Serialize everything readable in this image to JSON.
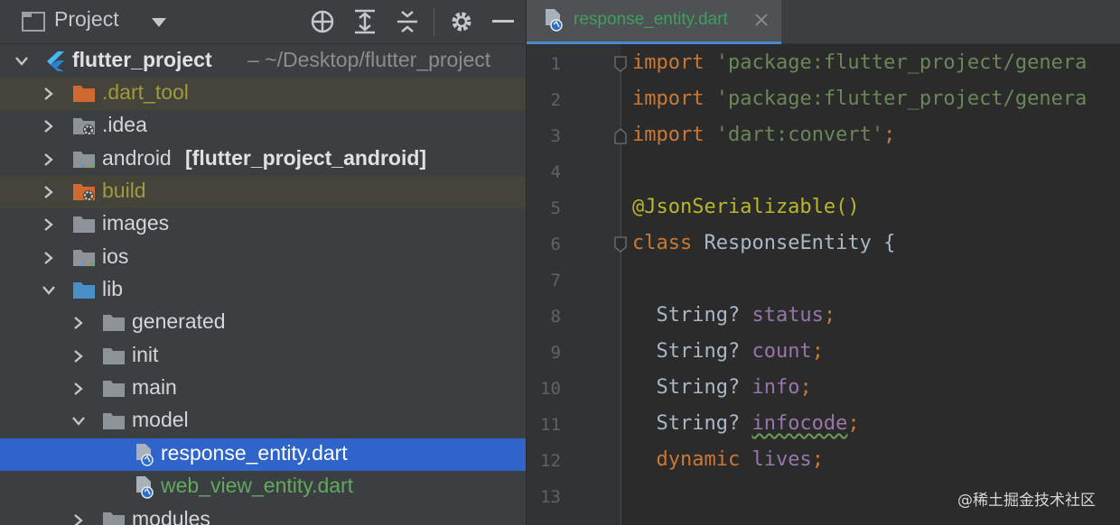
{
  "project_panel": {
    "title": "Project",
    "header_icons": [
      "crosshair-icon",
      "expand-all-icon",
      "collapse-all-icon",
      "gear-icon",
      "minimize-icon"
    ],
    "root": {
      "name": "flutter_project",
      "path": "~/Desktop/flutter_project"
    },
    "items": [
      {
        "label": ".dart_tool"
      },
      {
        "label": ".idea"
      },
      {
        "label": "android",
        "suffix": "[flutter_project_android]"
      },
      {
        "label": "build"
      },
      {
        "label": "images"
      },
      {
        "label": "ios"
      },
      {
        "label": "lib"
      },
      {
        "label": "generated"
      },
      {
        "label": "init"
      },
      {
        "label": "main"
      },
      {
        "label": "model"
      },
      {
        "label": "response_entity.dart"
      },
      {
        "label": "web_view_entity.dart"
      },
      {
        "label": "modules"
      }
    ]
  },
  "editor": {
    "tab": {
      "label": "response_entity.dart"
    },
    "line_numbers": [
      "1",
      "2",
      "3",
      "4",
      "5",
      "6",
      "7",
      "8",
      "9",
      "10",
      "11",
      "12",
      "13"
    ],
    "code": {
      "l1_kw": "import",
      "l1_str": " 'package:flutter_project/genera",
      "l2_kw": "import",
      "l2_str": " 'package:flutter_project/genera",
      "l3_kw": "import",
      "l3_str": " 'dart:convert'",
      "l3_end": ";",
      "l5_ann": "@JsonSerializable",
      "l5_rest": "()",
      "l6_kw": "class",
      "l6_rest": " ResponseEntity {",
      "l8_type": "  String? ",
      "l8_field": "status",
      "l8_end": ";",
      "l9_type": "  String? ",
      "l9_field": "count",
      "l9_end": ";",
      "l10_type": "  String? ",
      "l10_field": "info",
      "l10_end": ";",
      "l11_type": "  String? ",
      "l11_field": "infocode",
      "l11_end": ";",
      "l12_type": "  dynamic ",
      "l12_field": "lives",
      "l12_end": ";"
    }
  },
  "watermark": "@稀土掘金技术社区",
  "colors": {
    "selection": "#2f65ca",
    "excluded_bg": "#45443a",
    "excluded_text": "#9e9a3e",
    "dart_file_text": "#62a85f"
  }
}
